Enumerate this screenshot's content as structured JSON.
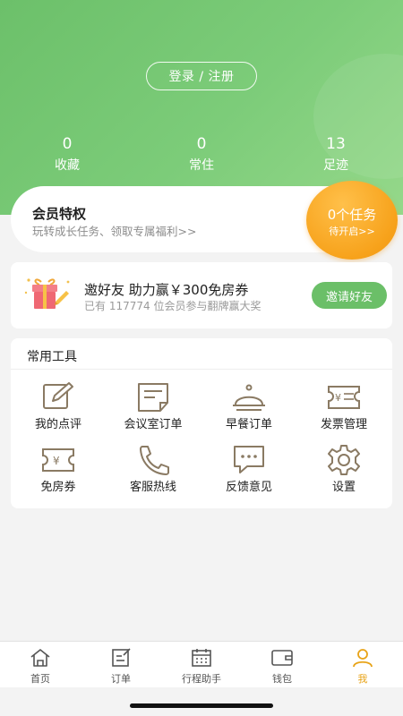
{
  "header": {
    "login_label": "登录 / 注册",
    "stats": [
      {
        "num": "0",
        "label": "收藏"
      },
      {
        "num": "0",
        "label": "常住"
      },
      {
        "num": "13",
        "label": "足迹"
      }
    ],
    "brand_color": "#6cc06a"
  },
  "member": {
    "title": "会员特权",
    "subtitle": "玩转成长任务、领取专属福利>>",
    "task_count": "0个任务",
    "task_status": "待开启>>",
    "accent": "#f7a21b"
  },
  "invite": {
    "title": "邀好友 助力赢￥300免房券",
    "subtitle": "已有 117774 位会员参与翻牌赢大奖",
    "button": "邀请好友",
    "icon": "gift-icon"
  },
  "tools": {
    "heading": "常用工具",
    "items": [
      {
        "label": "我的点评",
        "icon": "edit-icon"
      },
      {
        "label": "会议室订单",
        "icon": "document-icon"
      },
      {
        "label": "早餐订单",
        "icon": "cloche-icon"
      },
      {
        "label": "发票管理",
        "icon": "invoice-icon"
      },
      {
        "label": "免房券",
        "icon": "coupon-icon"
      },
      {
        "label": "客服热线",
        "icon": "phone-icon"
      },
      {
        "label": "反馈意见",
        "icon": "chat-icon"
      },
      {
        "label": "设置",
        "icon": "gear-icon"
      }
    ]
  },
  "tabbar": {
    "items": [
      {
        "label": "首页",
        "icon": "home-icon"
      },
      {
        "label": "订单",
        "icon": "order-icon"
      },
      {
        "label": "行程助手",
        "icon": "calendar-icon"
      },
      {
        "label": "钱包",
        "icon": "wallet-icon"
      },
      {
        "label": "我",
        "icon": "user-icon",
        "active": true
      }
    ],
    "active_color": "#e8a317"
  }
}
